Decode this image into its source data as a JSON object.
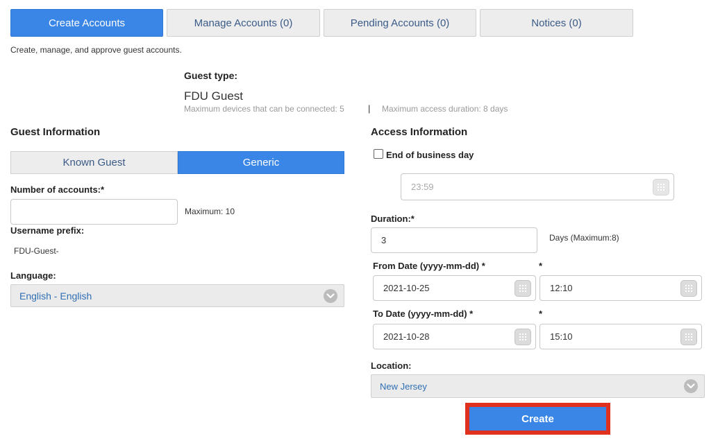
{
  "tabs": [
    {
      "label": "Create Accounts",
      "active": true
    },
    {
      "label": "Manage Accounts (0)",
      "active": false
    },
    {
      "label": "Pending Accounts (0)",
      "active": false
    },
    {
      "label": "Notices (0)",
      "active": false
    }
  ],
  "intro": "Create, manage, and approve guest accounts.",
  "guest_type": {
    "label": "Guest type:",
    "value": "FDU Guest",
    "max_devices": "Maximum devices that can be connected: 5",
    "separator": "|",
    "max_duration": "Maximum access duration: 8 days"
  },
  "guest_info": {
    "title": "Guest Information",
    "segments": {
      "known": "Known Guest",
      "generic": "Generic",
      "selected": "generic"
    },
    "num_accounts_label": "Number of accounts:*",
    "num_accounts_value": "",
    "maximum": "Maximum: 10",
    "prefix_label": "Username prefix:",
    "prefix_value": "FDU-Guest-",
    "language_label": "Language:",
    "language_value": "English - English"
  },
  "access_info": {
    "title": "Access Information",
    "eob_label": "End of business day",
    "eob_checked": false,
    "eob_time": "23:59",
    "duration_label": "Duration:*",
    "duration_value": "3",
    "duration_hint": "Days (Maximum:8)",
    "from_label": "From Date (yyyy-mm-dd) *",
    "from_time_label": "*",
    "from_date": "2021-10-25",
    "from_time": "12:10",
    "to_label": "To Date (yyyy-mm-dd) *",
    "to_time_label": "*",
    "to_date": "2021-10-28",
    "to_time": "15:10",
    "location_label": "Location:",
    "location_value": "New Jersey"
  },
  "actions": {
    "create_label": "Create"
  },
  "colors": {
    "accent": "#3a86e6",
    "highlight_border": "#e0301e"
  }
}
